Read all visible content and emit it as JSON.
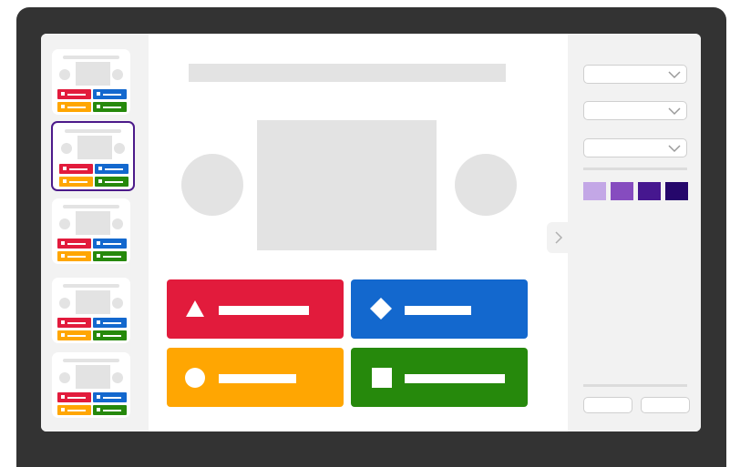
{
  "colors": {
    "frame": "#333333",
    "red": "#e21b3c",
    "blue": "#1368ce",
    "yellow": "#ffa602",
    "green": "#26890c",
    "selected_border": "#4c1a8a",
    "placeholder": "#e3e3e3",
    "panel_bg": "#f2f2f2"
  },
  "sidebar": {
    "slides": [
      {
        "selected": false
      },
      {
        "selected": true
      },
      {
        "selected": false
      },
      {
        "selected": false
      },
      {
        "selected": false
      }
    ]
  },
  "main": {
    "answers": [
      {
        "color": "#e21b3c",
        "icon": "triangle-icon"
      },
      {
        "color": "#1368ce",
        "icon": "diamond-icon"
      },
      {
        "color": "#ffa602",
        "icon": "circle-icon"
      },
      {
        "color": "#26890c",
        "icon": "square-icon"
      }
    ]
  },
  "panel": {
    "dropdowns": [
      {
        "value": ""
      },
      {
        "value": ""
      },
      {
        "value": ""
      }
    ],
    "swatches": [
      "#c3a7e6",
      "#864cbf",
      "#46178f",
      "#25076b"
    ],
    "icons": {
      "dropdown": "chevron-down-icon",
      "collapse": "chevron-right-icon"
    }
  }
}
